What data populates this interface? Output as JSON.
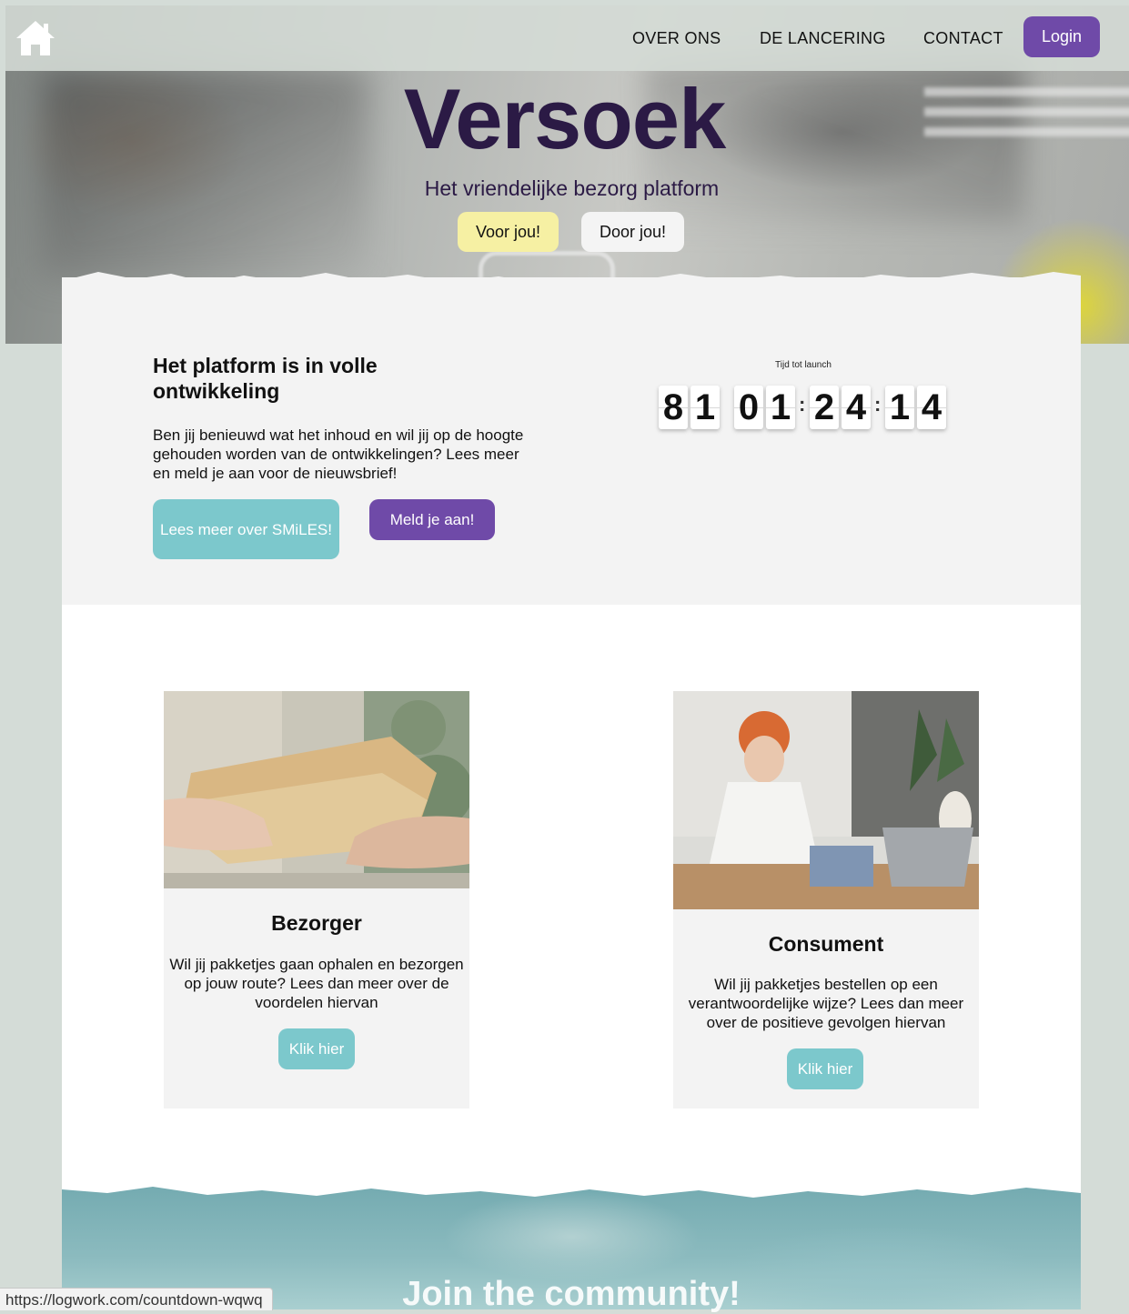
{
  "nav": {
    "links": [
      "OVER ONS",
      "DE LANCERING",
      "CONTACT"
    ],
    "login_label": "Login"
  },
  "hero": {
    "brand": "Versoek",
    "tagline": "Het vriendelijke bezorg platform",
    "btn_voor": "Voor jou!",
    "btn_door": "Door jou!"
  },
  "development": {
    "title": "Het platform is in volle ontwikkeling",
    "text": "Ben jij benieuwd wat het inhoud en wil jij op de hoogte gehouden worden van de ontwikkelingen? Lees meer en meld je aan voor de nieuwsbrief!",
    "btn_more": "Lees meer over SMiLES!",
    "btn_signup": "Meld je aan!"
  },
  "countdown": {
    "label": "Tijd tot launch",
    "digits": [
      "8",
      "1",
      "0",
      "1",
      "2",
      "4",
      "1",
      "4"
    ]
  },
  "cards": [
    {
      "title": "Bezorger",
      "text": "Wil jij pakketjes gaan ophalen en bezorgen op jouw route? Lees dan meer over de voordelen hiervan",
      "button": "Klik hier"
    },
    {
      "title": "Consument",
      "text": "Wil jij pakketjes bestellen op een verantwoordelijke wijze? Lees dan meer over de positieve gevolgen hiervan",
      "button": "Klik hier"
    }
  ],
  "community": {
    "title": "Join the community!"
  },
  "status_bar": {
    "url": "https://logwork.com/countdown-wqwq"
  },
  "colors": {
    "purple": "#6f4aa8",
    "teal": "#7cc8cc",
    "yellow": "#f6f0a3",
    "brand_text": "#2b1a45",
    "page_bg": "#d4dcd7"
  }
}
